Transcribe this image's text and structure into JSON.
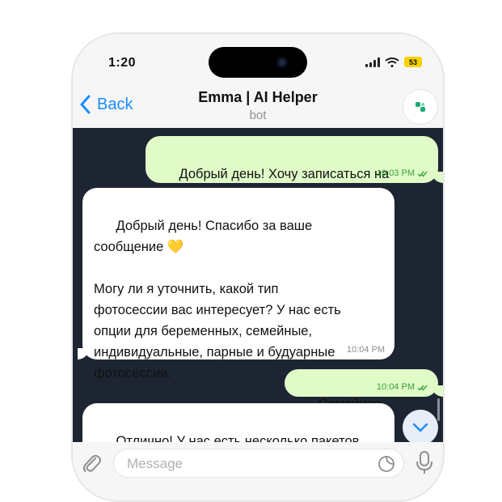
{
  "status": {
    "time": "1:20",
    "battery": "53"
  },
  "nav": {
    "back_label": "Back",
    "title": "Emma | AI Helper",
    "subtitle": "bot"
  },
  "messages": [
    {
      "dir": "out",
      "text": "Добрый день! Хочу записаться на\nфотосессию. Какие условия?",
      "time": "10:03 PM",
      "read": true
    },
    {
      "dir": "in",
      "text": "Добрый день! Спасибо за ваше\nсообщение 💛\n\nМогу ли я уточнить, какой тип\nфотосессии вас интересует? У нас есть\nопции для беременных, семейные,\nиндивидуальные, парные и будуарные\nфотосессии.",
      "time": "10:04 PM"
    },
    {
      "dir": "out",
      "text": "Семейная",
      "time": "10:04 PM",
      "read": true
    },
    {
      "dir": "in",
      "text": "Отлично! У нас есть несколько пакетов\nна выбор. Вот они:",
      "time": ""
    }
  ],
  "input": {
    "placeholder": "Message",
    "value": ""
  },
  "colors": {
    "accent": "#1a8cff",
    "chat_bg": "#1d2533",
    "outgoing": "#e0fbc8",
    "incoming": "#ffffff",
    "read_check": "#3aa13a"
  },
  "icons": [
    "back-chevron-icon",
    "bot-avatar-icon",
    "double-check-icon",
    "chevron-down-icon",
    "paperclip-icon",
    "sticker-icon",
    "microphone-icon"
  ]
}
